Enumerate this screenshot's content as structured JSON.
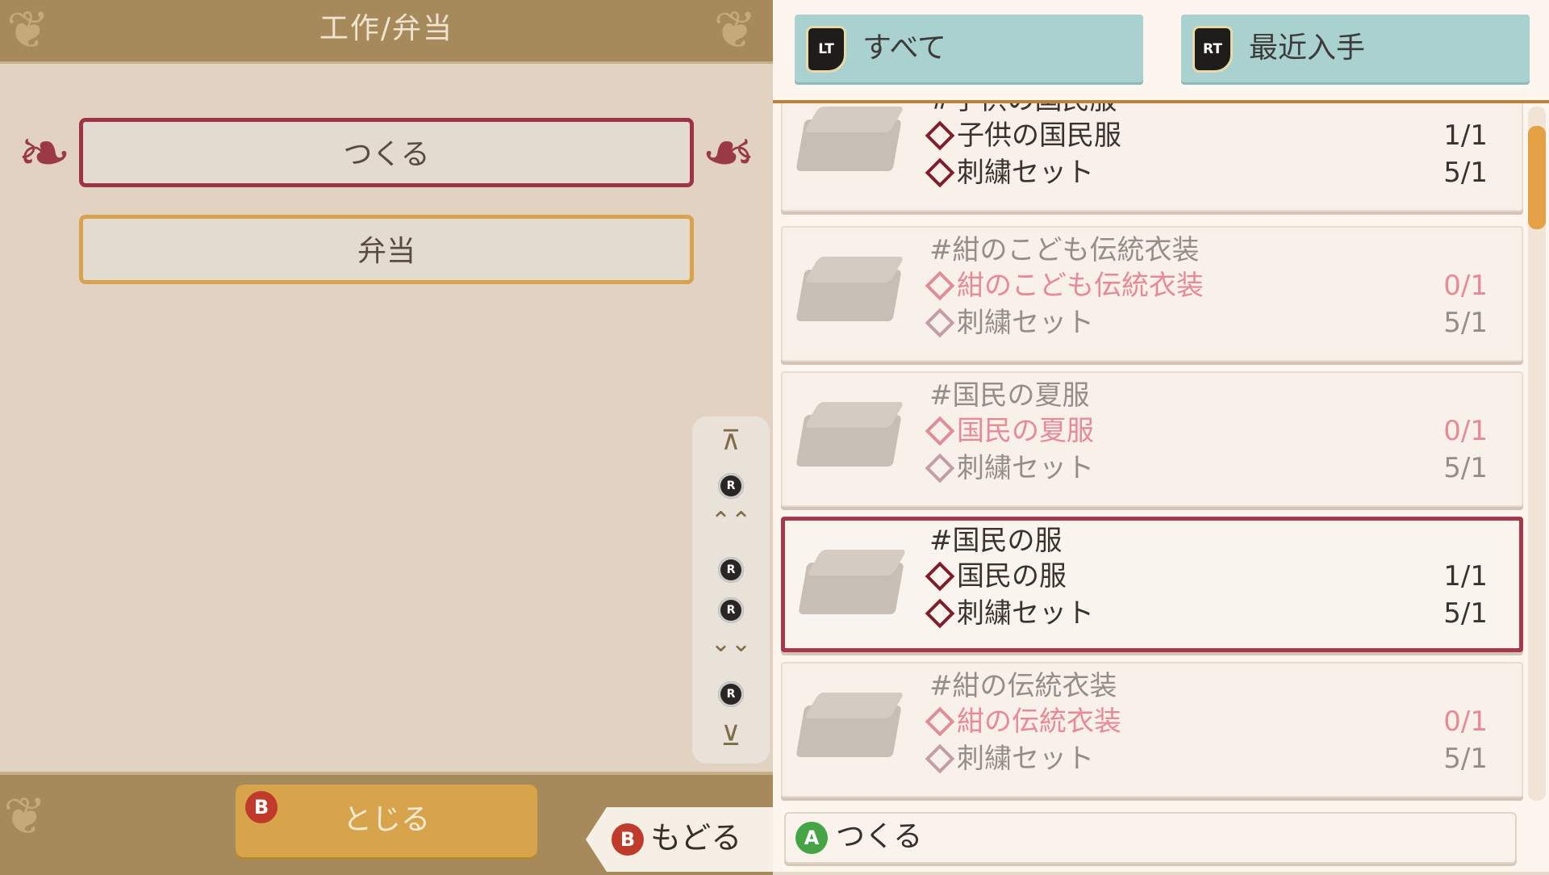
{
  "left_panel": {
    "title": "工作/弁当",
    "menu": [
      {
        "label": "つくる",
        "selected": true
      },
      {
        "label": "弁当",
        "selected": false
      }
    ],
    "close_button": {
      "badge": "B",
      "label": "とじる"
    }
  },
  "scroll_legend": {
    "top_glyph": "⊼",
    "r_label": "R",
    "page_up_glyph": "⌃⌃",
    "page_down_glyph": "⌄⌄",
    "bottom_glyph": "⊻"
  },
  "back_button": {
    "badge": "B",
    "label": "もどる"
  },
  "tabs": [
    {
      "badge": "LT",
      "label": "すべて"
    },
    {
      "badge": "RT",
      "label": "最近入手"
    }
  ],
  "recipes": [
    {
      "title": "#子供の国民服",
      "available": true,
      "materials": [
        {
          "name": "子供の国民服",
          "qty": "1/1"
        },
        {
          "name": "刺繍セット",
          "qty": "5/1"
        }
      ]
    },
    {
      "title": "#紺のこども伝統衣装",
      "available": false,
      "materials": [
        {
          "name": "紺のこども伝統衣装",
          "qty": "0/1"
        },
        {
          "name": "刺繍セット",
          "qty": "5/1"
        }
      ]
    },
    {
      "title": "#国民の夏服",
      "available": false,
      "materials": [
        {
          "name": "国民の夏服",
          "qty": "0/1"
        },
        {
          "name": "刺繍セット",
          "qty": "5/1"
        }
      ]
    },
    {
      "title": "#国民の服",
      "available": true,
      "selected": true,
      "materials": [
        {
          "name": "国民の服",
          "qty": "1/1"
        },
        {
          "name": "刺繍セット",
          "qty": "5/1"
        }
      ]
    },
    {
      "title": "#紺の伝統衣装",
      "available": false,
      "materials": [
        {
          "name": "紺の伝統衣装",
          "qty": "0/1"
        },
        {
          "name": "刺繍セット",
          "qty": "5/1"
        }
      ]
    }
  ],
  "make_button": {
    "badge": "A",
    "label": "つくる"
  },
  "colors": {
    "accent_red": "#a7374b",
    "accent_gold": "#d7a44c",
    "tab_teal": "#a8d1cf",
    "dim_pink": "#e88a95"
  }
}
